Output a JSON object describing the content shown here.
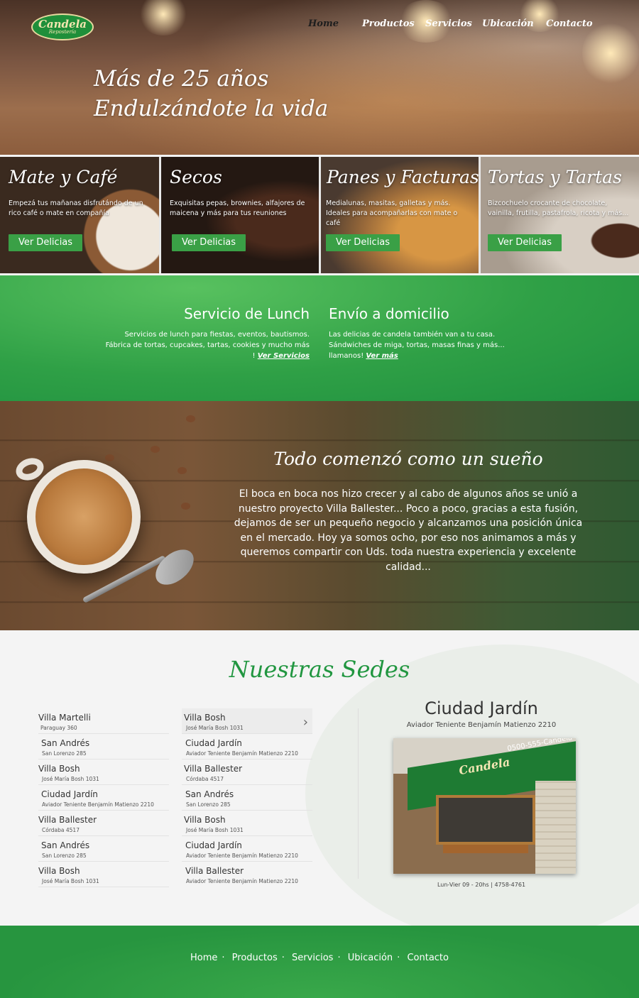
{
  "header": {
    "logo_name": "Candela",
    "logo_sub": "Repostería",
    "nav": [
      "Home",
      "Productos",
      "Servicios",
      "Ubicación",
      "Contacto"
    ],
    "hero_line1": "Más de 25 años",
    "hero_line2": "Endulzándote la vida"
  },
  "cards": [
    {
      "title": "Mate y Café",
      "text": "Empezá tus mañanas disfrutándo de un rico café o mate en compañía",
      "button": "Ver Delicias"
    },
    {
      "title": "Secos",
      "text": "Exquisitas pepas, brownies, alfajores de maicena y más para tus reuniones",
      "button": "Ver Delicias"
    },
    {
      "title": "Panes y Facturas",
      "text": "Medialunas, masitas, galletas y más. Ideales para acompañarlas con mate o café",
      "button": "Ver Delicias"
    },
    {
      "title": "Tortas y Tartas",
      "text": "Bizcochuelo crocante de chocolate, vainilla, frutilla, pastafrola, ricota y más...",
      "button": "Ver Delicias"
    }
  ],
  "services": [
    {
      "title": "Servicio de Lunch",
      "text": "Servicios de lunch para fiestas, eventos, bautismos. Fábrica de tortas, cupcakes, tartas, cookies y mucho más !",
      "link": "Ver Servicios"
    },
    {
      "title": "Envío a domicilio",
      "text": "Las delicias de candela también van a tu casa. Sándwiches de miga, tortas, masas finas  y más... llamanos!",
      "link": "Ver más"
    }
  ],
  "story": {
    "title": "Todo comenzó como un sueño",
    "text": "El boca en boca nos hizo crecer y al cabo de algunos años se unió a nuestro proyecto Villa Ballester... Poco a poco, gracias a esta fusión, dejamos de ser un pequeño negocio y alcanzamos una posición única en el mercado. Hoy ya somos ocho, por eso nos animamos a más y queremos compartir con Uds. toda nuestra experiencia y excelente calidad..."
  },
  "sedes": {
    "title": "Nuestras Sedes",
    "col1": [
      {
        "name": "Villa Martelli",
        "address": "Paraguay 360"
      },
      {
        "name": "San Andrés",
        "address": "San Lorenzo 285"
      },
      {
        "name": "Villa Bosh",
        "address": "José María Bosh 1031"
      },
      {
        "name": "Ciudad Jardín",
        "address": "Aviador Teniente Benjamín Matienzo 2210"
      },
      {
        "name": "Villa Ballester",
        "address": "Córdaba 4517"
      },
      {
        "name": "San Andrés",
        "address": "San Lorenzo 285"
      },
      {
        "name": "Villa Bosh",
        "address": "José María Bosh 1031"
      }
    ],
    "col2": [
      {
        "name": "Villa Bosh",
        "address": "José María Bosh 1031"
      },
      {
        "name": "Ciudad Jardín",
        "address": "Aviador Teniente Benjamín Matienzo 2210"
      },
      {
        "name": "Villa Ballester",
        "address": "Córdaba 4517"
      },
      {
        "name": "San Andrés",
        "address": "San Lorenzo 285"
      },
      {
        "name": "Villa Bosh",
        "address": "José María Bosh 1031"
      },
      {
        "name": "Ciudad Jardín",
        "address": "Aviador Teniente Benjamín Matienzo 2210"
      },
      {
        "name": "Villa Ballester",
        "address": "Aviador Teniente Benjamín Matienzo 2210"
      }
    ],
    "selected": {
      "name": "Ciudad Jardín",
      "address": "Aviador Teniente Benjamín Matienzo 2210",
      "hours": "Lun-Vier 09 - 20hs  |  4758-4761",
      "photo_brand": "Candela",
      "photo_phone": "0500-555-Candela"
    }
  },
  "footer": {
    "links": [
      "Home",
      "Productos",
      "Servicios",
      "Ubicación",
      "Contacto"
    ],
    "separator": "·"
  },
  "colors": {
    "brand_green": "#219640",
    "button_green": "#3aa046"
  }
}
